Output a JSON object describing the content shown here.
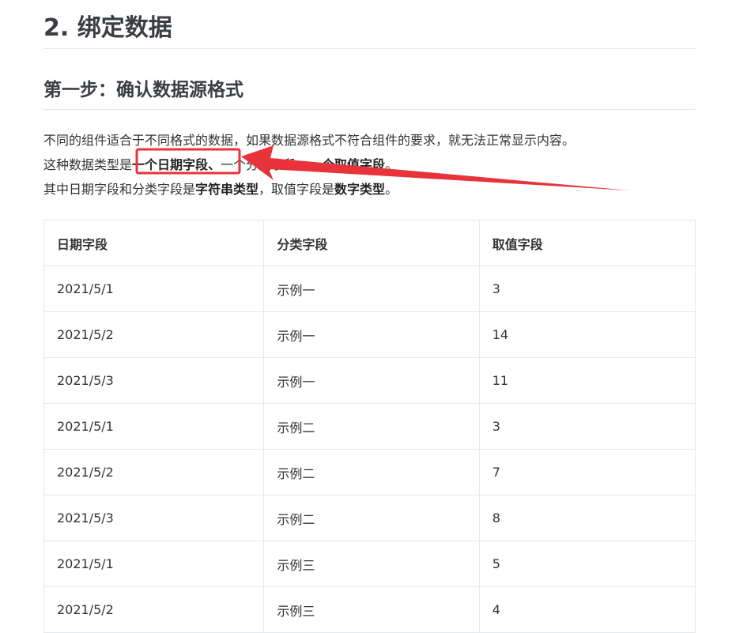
{
  "section_title": "2. 绑定数据",
  "step_title": "第一步：确认数据源格式",
  "para": {
    "line1": "不同的组件适合于不同格式的数据，如果数据源格式不符合组件的要求，就无法正常显示内容。",
    "line2_prefix": "这种数据类型是",
    "line2_bold1": "一个日期字段、",
    "line2_mid": "一个分类字段、",
    "line2_bold2": "一个取值字段",
    "line2_suffix": "。",
    "line3_a": "其中日期字段和分类字段是",
    "line3_bold1": "字符串类型",
    "line3_b": "，取值字段是",
    "line3_bold2": "数字类型",
    "line3_c": "。"
  },
  "table": {
    "headers": [
      "日期字段",
      "分类字段",
      "取值字段"
    ],
    "rows": [
      [
        "2021/5/1",
        "示例一",
        "3"
      ],
      [
        "2021/5/2",
        "示例一",
        "14"
      ],
      [
        "2021/5/3",
        "示例一",
        "11"
      ],
      [
        "2021/5/1",
        "示例二",
        "3"
      ],
      [
        "2021/5/2",
        "示例二",
        "7"
      ],
      [
        "2021/5/3",
        "示例二",
        "8"
      ],
      [
        "2021/5/1",
        "示例三",
        "5"
      ],
      [
        "2021/5/2",
        "示例三",
        "4"
      ]
    ]
  },
  "colors": {
    "annotation": "#e8333a",
    "text": "#333333",
    "heading": "#3a3d42",
    "border": "#e6e8eb"
  }
}
